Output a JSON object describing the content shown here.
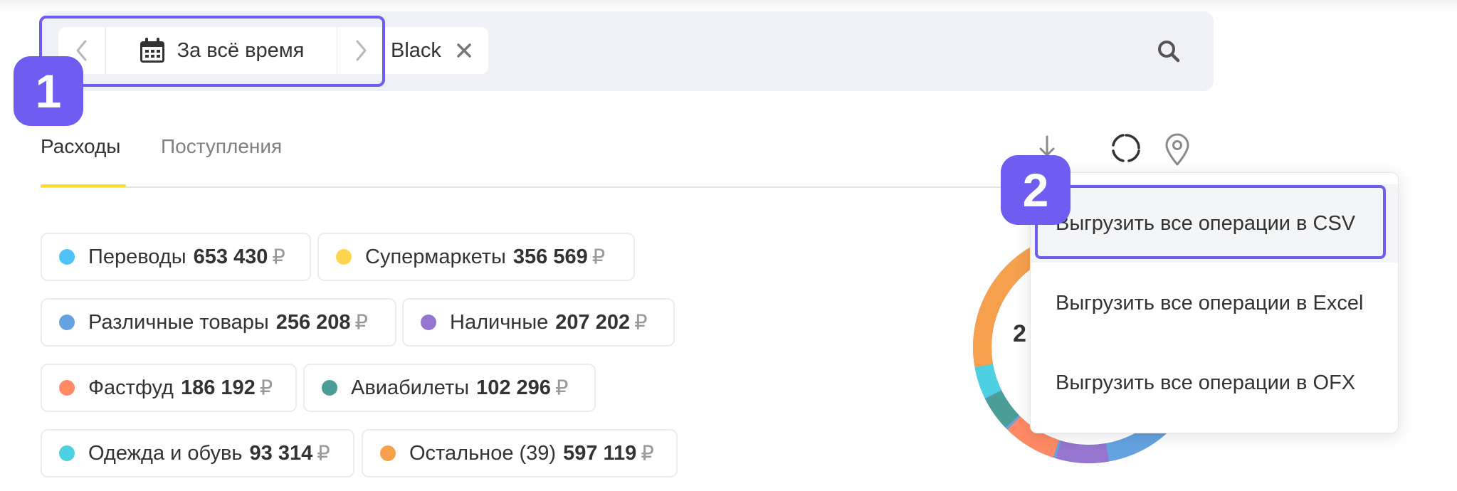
{
  "filter_bar": {
    "date_label": "За всё время",
    "card_filter_label": "Black",
    "icons": [
      "chevron-left",
      "calendar",
      "chevron-right",
      "close",
      "search"
    ]
  },
  "callouts": {
    "first": "1",
    "second": "2"
  },
  "tabs": [
    {
      "label": "Расходы",
      "active": true
    },
    {
      "label": "Поступления",
      "active": false
    }
  ],
  "toolbar": {
    "icons": [
      "download",
      "refresh",
      "map-pin"
    ]
  },
  "categories": [
    {
      "name": "Переводы",
      "amount": "653 430",
      "currency": "₽",
      "color": "#4fc3f7"
    },
    {
      "name": "Супермаркеты",
      "amount": "356 569",
      "currency": "₽",
      "color": "#ffd54f"
    },
    {
      "name": "Различные товары",
      "amount": "256 208",
      "currency": "₽",
      "color": "#64a3e0"
    },
    {
      "name": "Наличные",
      "amount": "207 202",
      "currency": "₽",
      "color": "#9575cd"
    },
    {
      "name": "Фастфуд",
      "amount": "186 192",
      "currency": "₽",
      "color": "#ff8a65"
    },
    {
      "name": "Авиабилеты",
      "amount": "102 296",
      "currency": "₽",
      "color": "#4a9e96"
    },
    {
      "name": "Одежда и обувь",
      "amount": "93 314",
      "currency": "₽",
      "color": "#4dd0e1"
    },
    {
      "name": "Остальное (39)",
      "amount": "597 119",
      "currency": "₽",
      "color": "#f6a04d"
    }
  ],
  "donut": {
    "total_visible": "2"
  },
  "export_menu": {
    "csv_label": "Выгрузить все операции в CSV",
    "excel_label": "Выгрузить все операции в Excel",
    "ofx_label": "Выгрузить все операции в OFX"
  },
  "colors": {
    "accent_purple": "#6f5cf0",
    "tab_underline": "#ffdd2d",
    "bar_bg": "#eff1f6"
  }
}
